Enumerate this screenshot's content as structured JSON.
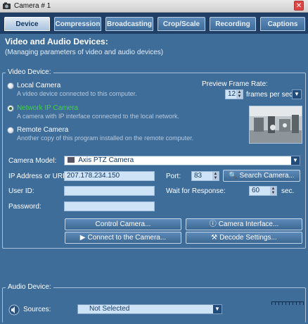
{
  "window": {
    "title": "Camera # 1",
    "close_glyph": "✕"
  },
  "tabs": [
    {
      "label": "Device",
      "active": true
    },
    {
      "label": "Compression"
    },
    {
      "label": "Broadcasting"
    },
    {
      "label": "Crop/Scale"
    },
    {
      "label": "Recording"
    },
    {
      "label": "Captions"
    }
  ],
  "header": {
    "title": "Video and Audio Devices:",
    "subtitle": "(Managing parameters of video and audio devices)"
  },
  "video_device": {
    "legend": "Video Device:",
    "options": [
      {
        "label": "Local Camera",
        "desc": "A video device connected to this computer.",
        "selected": false
      },
      {
        "label": "Network IP Camera",
        "desc": "A camera with IP interface connected to the local network.",
        "selected": true
      },
      {
        "label": "Remote Camera",
        "desc": "Another copy of this program installed on the remote computer.",
        "selected": false
      }
    ],
    "preview_rate": {
      "label": "Preview Frame Rate:",
      "value": "12",
      "unit": "frames per sec."
    },
    "camera_model": {
      "label": "Camera Model:",
      "value": "Axis PTZ Camera"
    },
    "ip": {
      "label": "IP Address or URL:",
      "value": "207.178.234.150"
    },
    "port": {
      "label": "Port:",
      "value": "83"
    },
    "search_button": "Search Camera...",
    "user": {
      "label": "User ID:",
      "value": ""
    },
    "wait": {
      "label": "Wait for Response:",
      "value": "60",
      "unit": "sec."
    },
    "password": {
      "label": "Password:",
      "value": ""
    },
    "buttons": {
      "control": "Control Camera...",
      "interface": "Camera Interface...",
      "connect": "Connect to the Camera...",
      "decode": "Decode Settings..."
    }
  },
  "audio_device": {
    "legend": "Audio Device:",
    "sources": {
      "label": "Sources:",
      "value": "Not Selected"
    }
  },
  "colors": {
    "accent": "#3f6d9a",
    "selected_option": "#3fd43f",
    "tab_bar": "#1f3f66"
  }
}
